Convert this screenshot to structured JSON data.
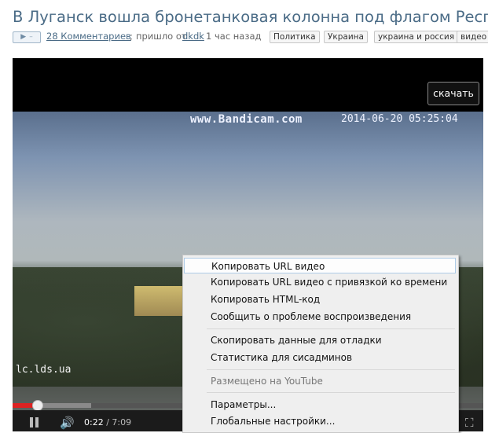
{
  "article": {
    "title": "В Луганск вошла бронетанковая колонна под флагом Республики",
    "play_glyph": "▶",
    "minus_glyph": "–",
    "comments": "28 Комментариев",
    "sep": ";",
    "from": "пришло от",
    "author": "dkdk",
    "time": "1 час назад",
    "tags": [
      "Политика",
      "Украина",
      "украина и россия",
      "видео"
    ]
  },
  "video": {
    "download_label": "скачать",
    "watermark_site": "www.Bandicam.com",
    "watermark_time": "2014-06-20 05:25:04",
    "watermark_corner": "lc.lds.ua",
    "current_time": "0:22",
    "duration": "/ 7:09",
    "progress_fraction": 0.051,
    "icons": {
      "volume": "🔊",
      "fullscreen": "⛶"
    }
  },
  "context_menu": {
    "items": [
      {
        "label": "Копировать URL видео"
      },
      {
        "label": "Копировать URL видео с привязкой ко времени"
      },
      {
        "label": "Копировать HTML-код"
      },
      {
        "label": "Сообщить о проблеме воспроизведения"
      },
      {
        "label": "Скопировать данные для отладки"
      },
      {
        "label": "Статистика для сисадминов"
      },
      {
        "label": "Размещено на YouTube"
      },
      {
        "label": "Параметры..."
      },
      {
        "label": "Глобальные настройки..."
      }
    ]
  }
}
